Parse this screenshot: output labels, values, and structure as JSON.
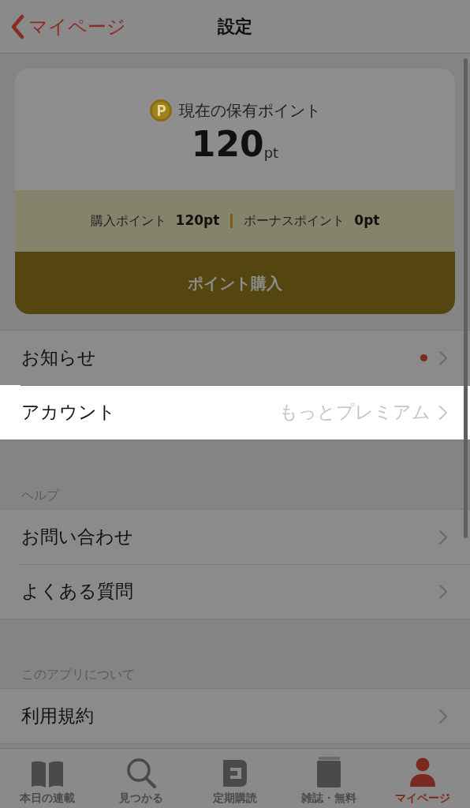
{
  "nav": {
    "back_label": "マイページ",
    "title": "設定"
  },
  "points": {
    "caption": "現在の保有ポイント",
    "total": "120",
    "unit": "pt",
    "purchased_label": "購入ポイント",
    "purchased_value": "120pt",
    "bonus_label": "ボーナスポイント",
    "bonus_value": "0pt",
    "buy_button": "ポイント購入"
  },
  "sections": [
    {
      "rows": [
        {
          "label": "お知らせ",
          "badge_dot": true,
          "highlighted": false
        },
        {
          "label": "アカウント",
          "value": "もっとプレミアム",
          "badge_dot": false,
          "highlighted": true
        }
      ]
    },
    {
      "header": "ヘルプ",
      "rows": [
        {
          "label": "お問い合わせ",
          "badge_dot": false,
          "highlighted": false
        },
        {
          "label": "よくある質問",
          "badge_dot": false,
          "highlighted": false
        }
      ]
    },
    {
      "header": "このアプリについて",
      "rows": [
        {
          "label": "利用規約",
          "badge_dot": false,
          "highlighted": false
        }
      ]
    }
  ],
  "tab_bar": [
    {
      "kind": "book",
      "label": "本日の連載",
      "selected": false
    },
    {
      "kind": "search",
      "label": "見つかる",
      "selected": false
    },
    {
      "kind": "subscription",
      "label": "定期購読",
      "selected": false
    },
    {
      "kind": "magazine",
      "label": "雑誌・無料",
      "selected": false
    },
    {
      "kind": "person",
      "label": "マイページ",
      "selected": true
    }
  ]
}
